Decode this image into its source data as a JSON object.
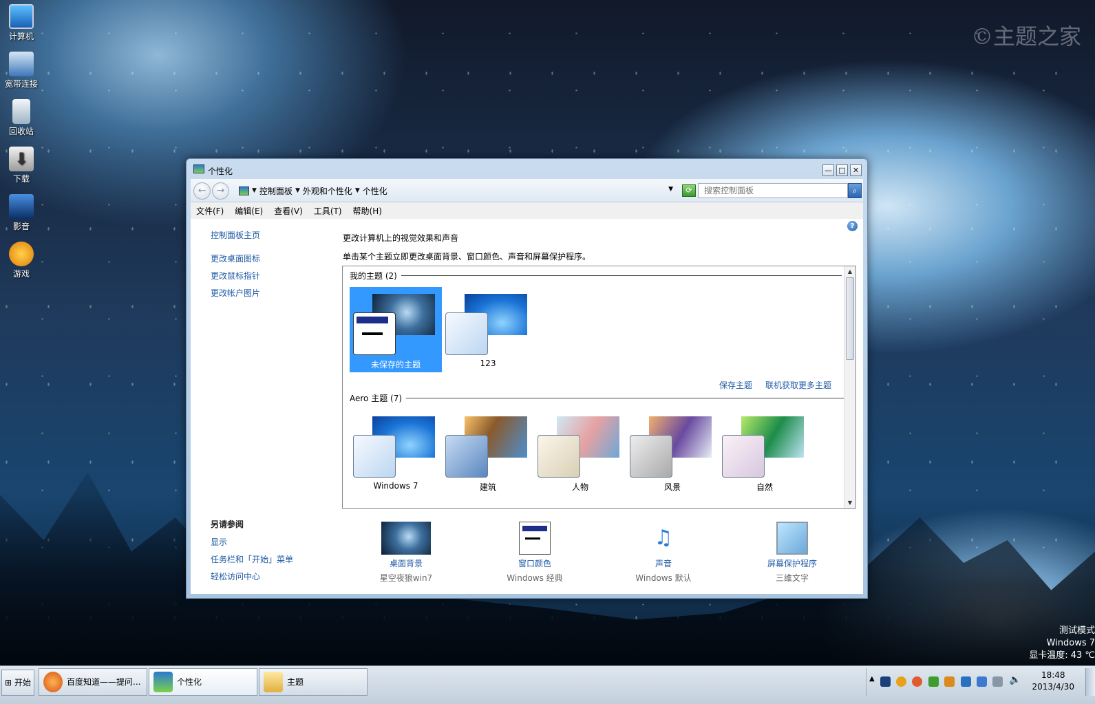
{
  "desktop": {
    "icons": [
      {
        "label": "计算机",
        "icon": "computer-icon"
      },
      {
        "label": "宽带连接",
        "icon": "network-icon"
      },
      {
        "label": "回收站",
        "icon": "recycle-bin-icon"
      },
      {
        "label": "下载",
        "icon": "download-icon"
      },
      {
        "label": "影音",
        "icon": "media-icon"
      },
      {
        "label": "游戏",
        "icon": "game-icon"
      }
    ],
    "watermark": "©主题之家",
    "corner_text": [
      "测试模式",
      "Windows 7",
      "显卡温度: 43 ℃"
    ]
  },
  "window": {
    "title": "个性化",
    "controls": {
      "minimize": "—",
      "maximize": "□",
      "close": "✕"
    },
    "breadcrumbs": [
      "控制面板",
      "外观和个性化",
      "个性化"
    ],
    "search_placeholder": "搜索控制面板",
    "menu": [
      "文件(F)",
      "编辑(E)",
      "查看(V)",
      "工具(T)",
      "帮助(H)"
    ],
    "sidebar": {
      "home": "控制面板主页",
      "links": [
        "更改桌面图标",
        "更改鼠标指针",
        "更改帐户图片"
      ],
      "see_also_title": "另请参阅",
      "see_also": [
        "显示",
        "任务栏和「开始」菜单",
        "轻松访问中心"
      ]
    },
    "heading": "更改计算机上的视觉效果和声音",
    "subheading": "单击某个主题立即更改桌面背景、窗口颜色、声音和屏幕保护程序。",
    "groups": {
      "my": {
        "title": "我的主题 (2)",
        "themes": [
          {
            "name": "未保存的主题",
            "selected": true
          },
          {
            "name": "123",
            "selected": false
          }
        ],
        "actions": [
          "保存主题",
          "联机获取更多主题"
        ]
      },
      "aero": {
        "title": "Aero 主题 (7)",
        "themes": [
          "Windows 7",
          "建筑",
          "人物",
          "风景",
          "自然"
        ]
      }
    },
    "bottom": [
      {
        "title": "桌面背景",
        "value": "星空夜狼win7"
      },
      {
        "title": "窗口颜色",
        "value": "Windows 经典"
      },
      {
        "title": "声音",
        "value": "Windows 默认"
      },
      {
        "title": "屏幕保护程序",
        "value": "三维文字"
      }
    ]
  },
  "taskbar": {
    "start": "开始",
    "buttons": [
      "百度知道——提问...",
      "个性化",
      "主题"
    ],
    "clock": {
      "time": "18:48",
      "date": "2013/4/30"
    }
  }
}
